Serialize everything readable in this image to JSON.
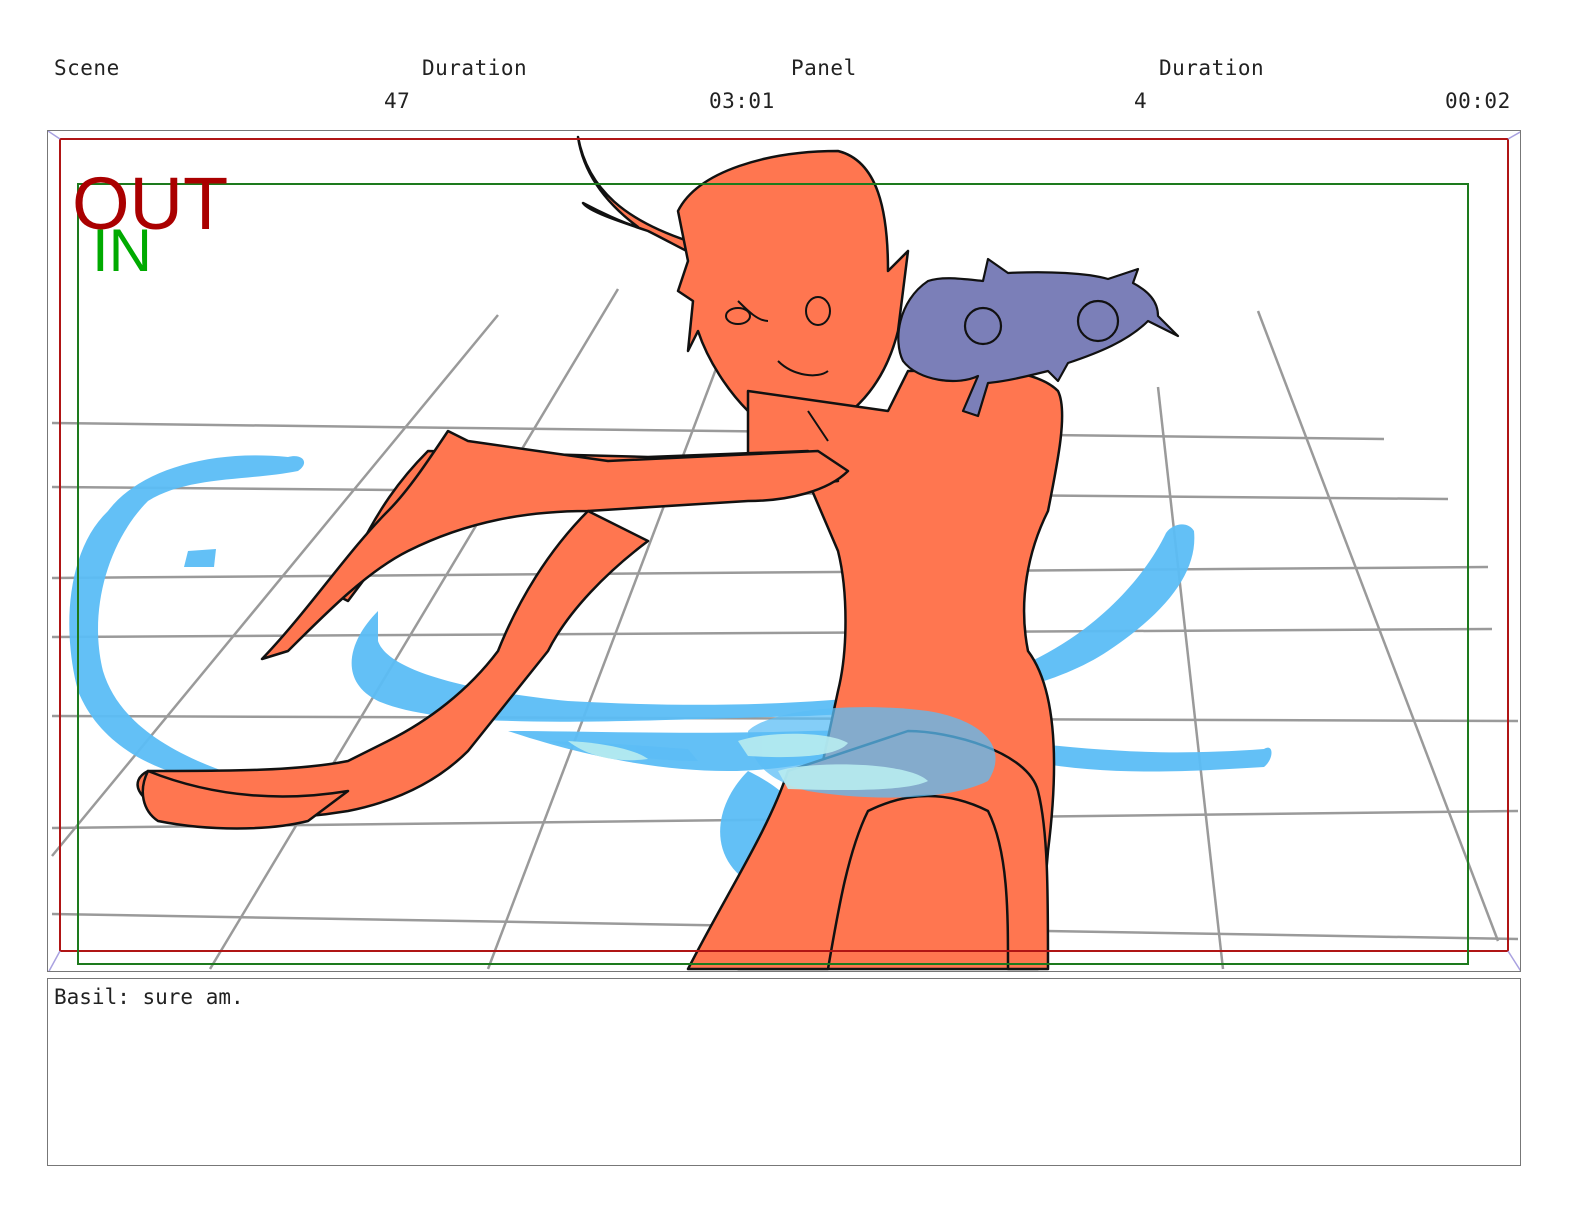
{
  "header": {
    "scene_label": "Scene",
    "scene_value": "47",
    "scene_duration_label": "Duration",
    "scene_duration_value": "03:01",
    "panel_label": "Panel",
    "panel_value": "4",
    "panel_duration_label": "Duration",
    "panel_duration_value": "00:02"
  },
  "frame": {
    "out_label": "OUT",
    "in_label": "IN",
    "out_color": "#aa0000",
    "in_color": "#00aa00"
  },
  "dialogue": {
    "text": "Basil: sure am."
  },
  "colors": {
    "skin": "#ff7650",
    "water": "#5bbdf6",
    "creature": "#7b7fb8",
    "grid": "#999999"
  }
}
